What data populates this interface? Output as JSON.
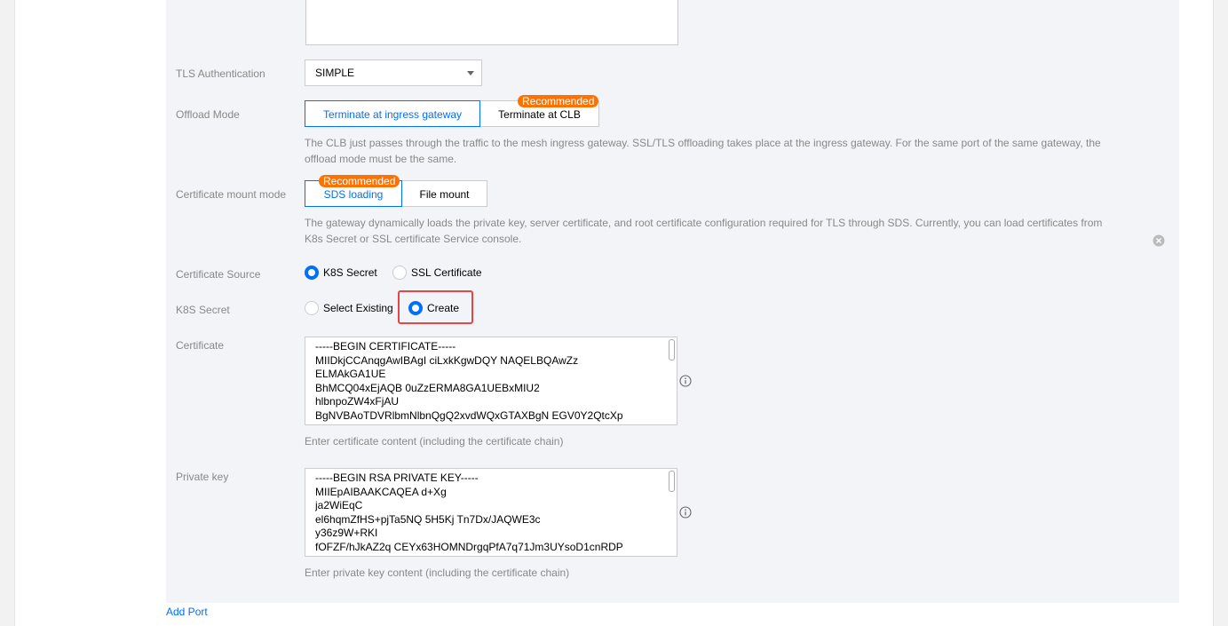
{
  "form": {
    "tls": {
      "label": "TLS Authentication",
      "value": "SIMPLE"
    },
    "offload": {
      "label": "Offload Mode",
      "options": [
        "Terminate at ingress gateway",
        "Terminate at CLB"
      ],
      "selected": 0,
      "badge": "Recommended",
      "help": "The CLB just passes through the traffic to the mesh ingress gateway. SSL/TLS offloading takes place at the ingress gateway. For the same port of the same gateway, the offload mode must be the same."
    },
    "mount": {
      "label": "Certificate mount mode",
      "options": [
        "SDS loading",
        "File mount"
      ],
      "selected": 0,
      "badge": "Recommended",
      "help": "The gateway dynamically loads the private key, server certificate, and root certificate configuration required for TLS through SDS. Currently, you can load certificates from K8s Secret or SSL certificate Service console."
    },
    "cert_source": {
      "label": "Certificate Source",
      "options": [
        "K8S Secret",
        "SSL Certificate"
      ],
      "selected": 0
    },
    "k8s_secret": {
      "label": "K8S Secret",
      "options": [
        "Select Existing",
        "Create"
      ],
      "selected": 1
    },
    "certificate": {
      "label": "Certificate",
      "lines": [
        "-----BEGIN CERTIFICATE-----",
        "MIIDkjCCAnqgAwIBAgI        ciLxkKgwDQY       NAQELBQAwZz",
        "ELMAkGA1UE",
        "BhMCQ04xEjAQB                          0uZzERMA8GA1UEBxMIU2",
        "hlbnpoZW4xFjAU",
        "BgNVBAoTDVRlbmNlbnQgQ2xvdWQxGTAXBgN           EGV0Y2QtcXp"
      ],
      "help": "Enter certificate content (including the certificate chain)"
    },
    "private_key": {
      "label": "Private key",
      "lines": [
        "-----BEGIN RSA PRIVATE KEY-----",
        "MIIEpAIBAAKCAQEA                                     d+Xg",
        "ja2WiEqC",
        "el6hqmZfHS+pjTa5NQ        5H5Kj                    Tn7Dx/JAQWE3c",
        "y36z9W+RKI",
        "fOFZF/hJkAZ2q        CEYx63HOMNDrgqPfA7q71Jm3UYsoD1cnRDP"
      ],
      "help": "Enter private key content (including the certificate chain)"
    }
  },
  "add_port": "Add Port",
  "colors": {
    "accent": "#006eff",
    "badge": "#ff7200",
    "highlight": "#e54545"
  }
}
